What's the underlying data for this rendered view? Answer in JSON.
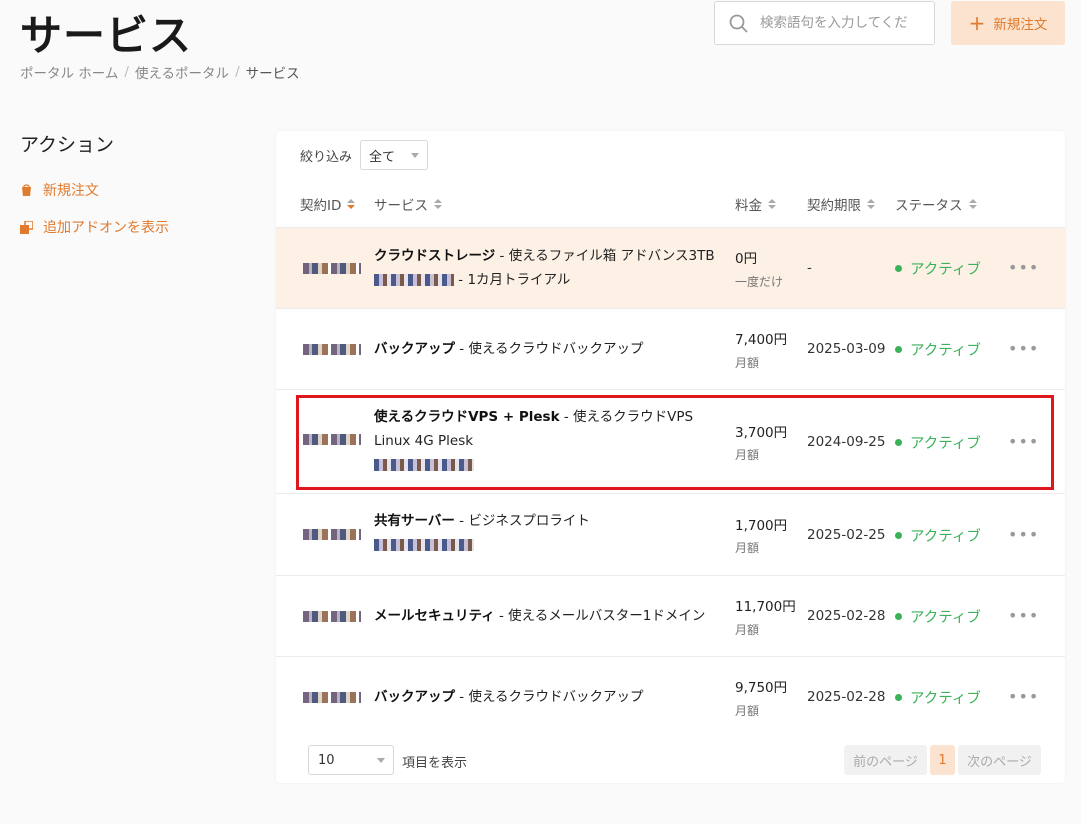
{
  "header": {
    "title": "サービス",
    "breadcrumb": [
      "ポータル ホーム",
      "使えるポータル",
      "サービス"
    ],
    "search_placeholder": "検索語句を入力してくだ",
    "new_order_label": "新規注文"
  },
  "sidebar": {
    "heading": "アクション",
    "items": [
      {
        "label": "新規注文",
        "icon": "cart-icon"
      },
      {
        "label": "追加アドオンを表示",
        "icon": "addon-icon"
      }
    ]
  },
  "table": {
    "filter_label": "絞り込み",
    "filter_value": "全て",
    "columns": [
      "契約ID",
      "サービス",
      "料金",
      "契約期限",
      "ステータス"
    ],
    "rows": [
      {
        "service_bold": "クラウドストレージ",
        "service_rest": " - 使えるファイル箱 アドバンス3TB",
        "service_tail": " - 1カ月トライアル",
        "price": "0円",
        "period": "一度だけ",
        "expiry": "-",
        "status": "アクティブ",
        "highlighted": true
      },
      {
        "service_bold": "バックアップ",
        "service_rest": " - 使えるクラウドバックアップ",
        "service_tail": "",
        "price": "7,400円",
        "period": "月額",
        "expiry": "2025-03-09",
        "status": "アクティブ",
        "highlighted": false
      },
      {
        "service_bold": "使えるクラウドVPS + Plesk",
        "service_rest": " - 使えるクラウドVPS Linux 4G Plesk",
        "service_tail": "",
        "price": "3,700円",
        "period": "月額",
        "expiry": "2024-09-25",
        "status": "アクティブ",
        "highlighted": false
      },
      {
        "service_bold": "共有サーバー",
        "service_rest": " - ビジネスプロライト",
        "service_tail": "",
        "price": "1,700円",
        "period": "月額",
        "expiry": "2025-02-25",
        "status": "アクティブ",
        "highlighted": false
      },
      {
        "service_bold": "メールセキュリティ",
        "service_rest": " - 使えるメールバスター1ドメイン",
        "service_tail": "",
        "price": "11,700円",
        "period": "月額",
        "expiry": "2025-02-28",
        "status": "アクティブ",
        "highlighted": false
      },
      {
        "service_bold": "バックアップ",
        "service_rest": " - 使えるクラウドバックアップ",
        "service_tail": "",
        "price": "9,750円",
        "period": "月額",
        "expiry": "2025-02-28",
        "status": "アクティブ",
        "highlighted": false
      }
    ],
    "more_symbol": "•••"
  },
  "pagination": {
    "per_page": "10",
    "per_page_label": "項目を表示",
    "prev_label": "前のページ",
    "current_page": "1",
    "next_label": "次のページ"
  },
  "colors": {
    "accent": "#e07a2e",
    "status_active": "#3bb15a",
    "highlight_row": "#fdf1e6",
    "annotation": "#e0161d"
  }
}
